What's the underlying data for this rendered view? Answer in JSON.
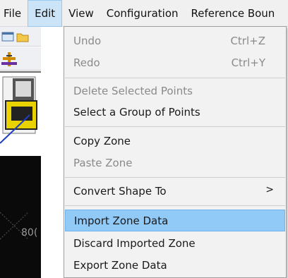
{
  "menubar": {
    "items": [
      {
        "label": "File"
      },
      {
        "label": "Edit"
      },
      {
        "label": "View"
      },
      {
        "label": "Configuration"
      },
      {
        "label": "Reference Boun"
      }
    ]
  },
  "canvas": {
    "label": "80("
  },
  "edit_menu": {
    "undo": {
      "label": "Undo",
      "shortcut": "Ctrl+Z"
    },
    "redo": {
      "label": "Redo",
      "shortcut": "Ctrl+Y"
    },
    "delete_selected_points": {
      "label": "Delete Selected Points"
    },
    "select_group_points": {
      "label": "Select a Group of Points"
    },
    "copy_zone": {
      "label": "Copy Zone"
    },
    "paste_zone": {
      "label": "Paste Zone"
    },
    "convert_shape": {
      "label": "Convert Shape To",
      "submenu_glyph": ">"
    },
    "import_zone_data": {
      "label": "Import Zone Data"
    },
    "discard_imported_zone": {
      "label": "Discard Imported Zone"
    },
    "export_zone_data": {
      "label": "Export Zone Data"
    }
  },
  "colors": {
    "highlight": "#91c9f7",
    "menu_background": "#f2f2f2",
    "disabled_text": "#8a8a8a"
  },
  "icons": [
    "new-document-icon",
    "open-folder-icon",
    "crosshair-tool-icon",
    "machine-graphic-icon"
  ]
}
